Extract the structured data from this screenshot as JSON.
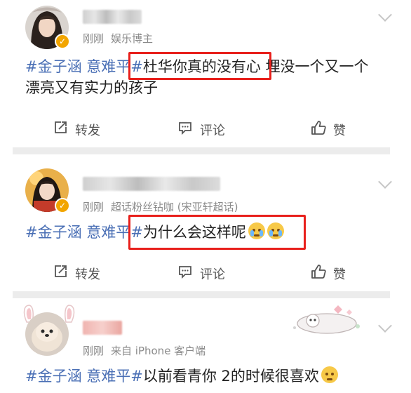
{
  "posts": [
    {
      "time": "刚刚",
      "source": "娱乐博主",
      "text": {
        "topic1": "#金子涵 意难平#",
        "boxed": "杜华你真的没有心",
        "rest1": "埋没一个又一个",
        "line2": "漂亮又有实力的孩子"
      },
      "actions": {
        "repost": "转发",
        "comment": "评论",
        "like": "赞"
      }
    },
    {
      "time": "刚刚",
      "source": "超话粉丝钻咖 (宋亚轩超话)",
      "text": {
        "topic1": "#金子涵 意难平#",
        "boxed": "为什么会这样呢"
      },
      "actions": {
        "repost": "转发",
        "comment": "评论",
        "like": "赞"
      }
    },
    {
      "time": "刚刚",
      "source": "来自 iPhone 客户端",
      "text": {
        "topic1": "#金子涵 意难平#",
        "body": "以前看青你 2的时候很喜欢"
      }
    }
  ],
  "icons": {
    "repost": "share-edit-icon",
    "comment": "comment-icon",
    "like": "thumbs-up-icon",
    "more": "chevron-down-icon",
    "verified": "verified-badge-icon"
  },
  "colors": {
    "topic": "#4a6fb5",
    "highlight_box": "#e8201c",
    "separator": "#ececec"
  }
}
